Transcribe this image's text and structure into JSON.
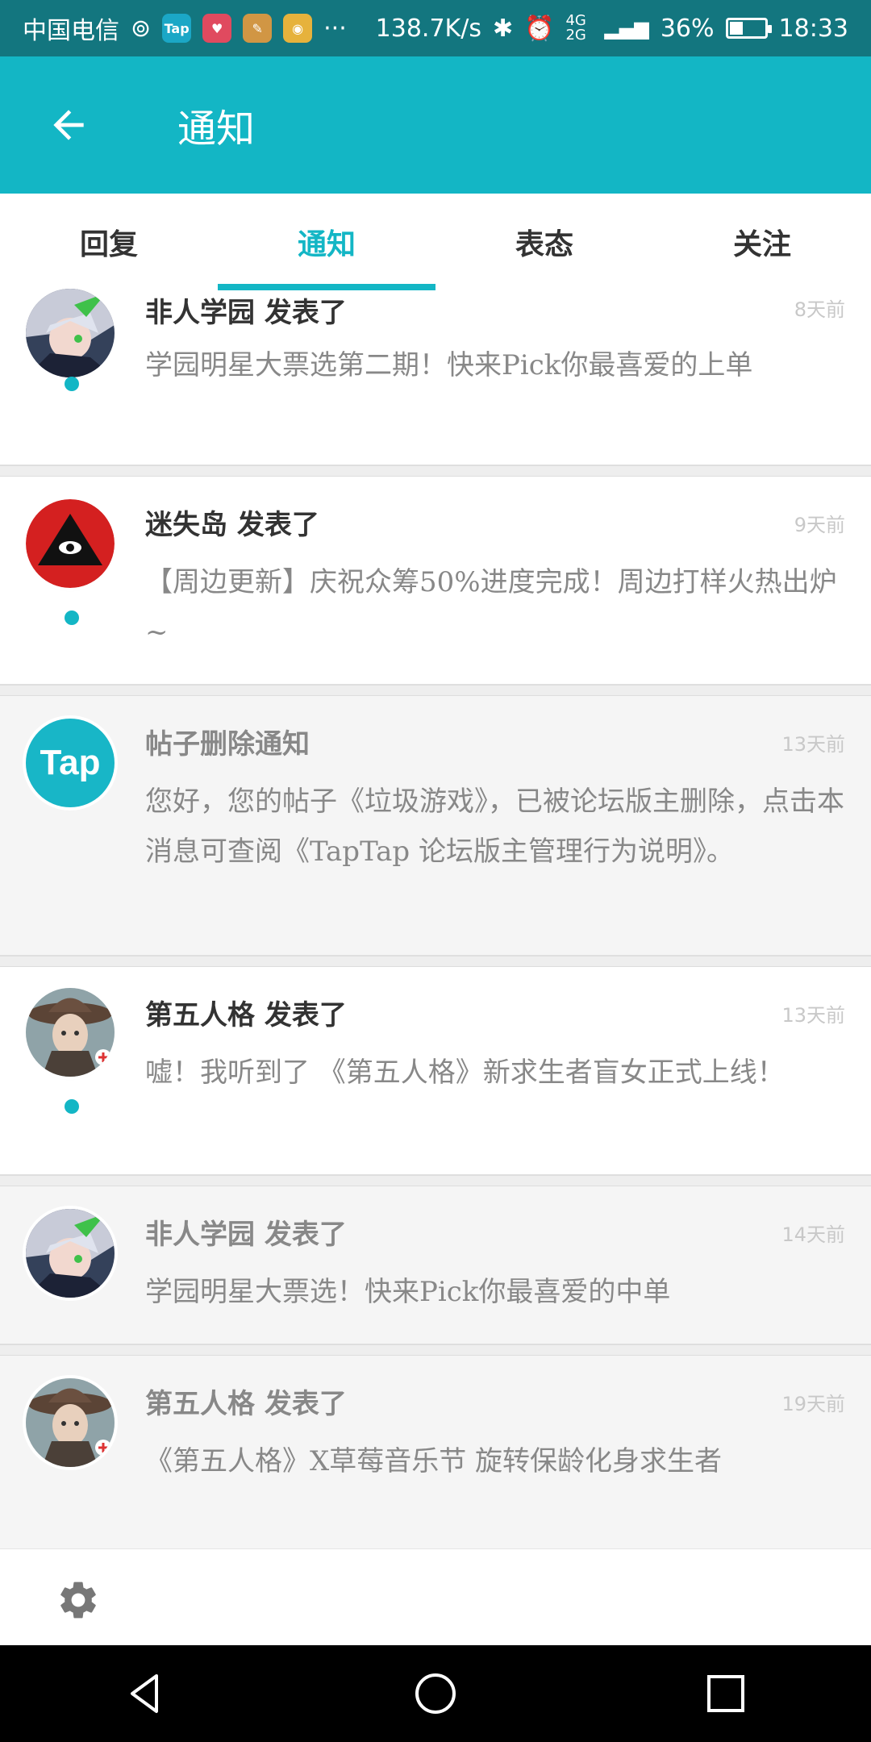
{
  "status_bar": {
    "carrier": "中国电信",
    "network_speed": "138.7K/s",
    "signal": "4G 2G",
    "battery": "36%",
    "time": "18:33",
    "apps": [
      {
        "label": "Tap",
        "color": "#1ba7c6"
      },
      {
        "label": "♥",
        "color": "#e04a5f"
      },
      {
        "label": "✎",
        "color": "#d19644"
      },
      {
        "label": "◉",
        "color": "#e6b23c"
      }
    ],
    "more": "···"
  },
  "appbar": {
    "title": "通知",
    "back_icon": "arrow-left-icon"
  },
  "tabs": [
    {
      "label": "回复",
      "active": false
    },
    {
      "label": "通知",
      "active": true
    },
    {
      "label": "表态",
      "active": false
    },
    {
      "label": "关注",
      "active": false
    }
  ],
  "notifications": [
    {
      "title": "非人学园 发表了",
      "time": "8天前",
      "body": "学园明星大票选第二期！快来Pick你最喜爱的上单",
      "unread": true,
      "avatar": "anime-avatar"
    },
    {
      "title": "迷失岛 发表了",
      "time": "9天前",
      "body": "【周边更新】庆祝众筹50%进度完成！周边打样火热出炉~",
      "unread": true,
      "avatar": "eye-triangle-avatar"
    },
    {
      "title": "帖子删除通知",
      "time": "13天前",
      "body": "您好，您的帖子《垃圾游戏》，已被论坛版主删除，点击本消息可查阅《TapTap 论坛版主管理行为说明》。",
      "unread": false,
      "avatar": "tap-logo-avatar",
      "avatar_text": "Tap"
    },
    {
      "title": "第五人格 发表了",
      "time": "13天前",
      "body": "嘘！我听到了 《第五人格》新求生者盲女正式上线！",
      "unread": true,
      "avatar": "girl-hat-avatar"
    },
    {
      "title": "非人学园 发表了",
      "time": "14天前",
      "body": "学园明星大票选！快来Pick你最喜爱的中单",
      "unread": false,
      "avatar": "anime-avatar"
    },
    {
      "title": "第五人格 发表了",
      "time": "19天前",
      "body": "《第五人格》X草莓音乐节 旋转保龄化身求生者",
      "unread": false,
      "avatar": "girl-hat-avatar"
    }
  ],
  "footer": {
    "settings_icon": "gear-icon"
  },
  "nav": {
    "back": "nav-back-icon",
    "home": "nav-home-icon",
    "recents": "nav-recents-icon"
  },
  "colors": {
    "accent": "#13b6c5",
    "status_bar": "#13767f"
  }
}
